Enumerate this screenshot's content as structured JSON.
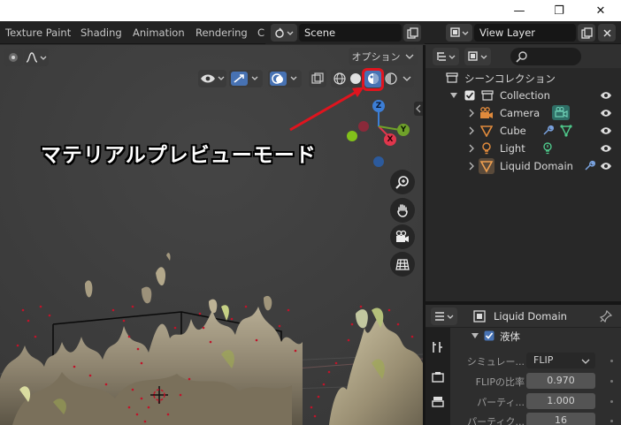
{
  "window": {
    "minimize": "—",
    "maximize": "❐",
    "close": "✕"
  },
  "workspace_tabs": [
    "Texture Paint",
    "Shading",
    "Animation",
    "Rendering",
    "C"
  ],
  "scene": {
    "name": "Scene",
    "view_layer": "View Layer"
  },
  "viewport": {
    "options_label": "オプション",
    "annotation": "マテリアルプレビューモード",
    "gizmo": {
      "z": "Z",
      "y": "Y",
      "x": "X"
    }
  },
  "outliner": {
    "root": "シーンコレクション",
    "collection": "Collection",
    "items": [
      {
        "label": "Camera"
      },
      {
        "label": "Cube"
      },
      {
        "label": "Light"
      },
      {
        "label": "Liquid Domain"
      }
    ]
  },
  "properties": {
    "object_name": "Liquid Domain",
    "panel_title": "液体",
    "rows": [
      {
        "label": "シミュレー...",
        "value": "FLIP"
      },
      {
        "label": "FLIPの比率",
        "value": "0.970"
      },
      {
        "label": "パーティ...",
        "value": "1.000"
      },
      {
        "label": "パーティク...",
        "value": "16"
      }
    ]
  },
  "colors": {
    "highlight": "#e0141e",
    "viewport_bg": "#3d3d3d",
    "axis_x": "#e0364c",
    "axis_y": "#6fa12a",
    "axis_z": "#3c7ed6"
  }
}
